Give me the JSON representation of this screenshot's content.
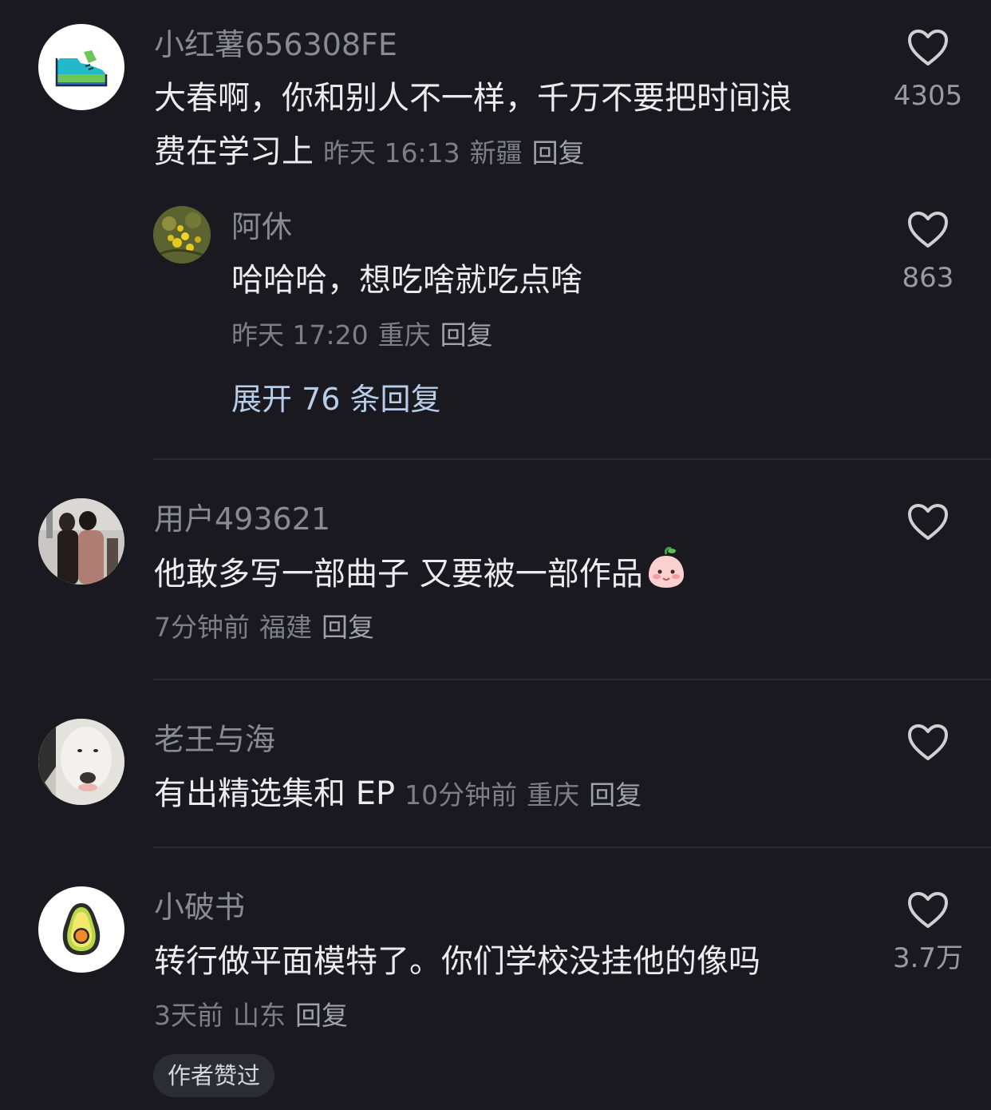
{
  "comments": [
    {
      "username": "小红薯656308FE",
      "text_line1": "大春啊，你和别人不一样，千万不要把时间浪",
      "text_line2": "费在学习上",
      "time": "昨天 16:13",
      "location": "新疆",
      "reply_label": "回复",
      "likes": "4305",
      "avatar_icon": "sneaker-icon",
      "reply": {
        "username": "阿休",
        "text": "哈哈哈，想吃啥就吃点啥",
        "time": "昨天 17:20",
        "location": "重庆",
        "reply_label": "回复",
        "likes": "863",
        "avatar_icon": "yellow-flowers-photo"
      },
      "expand_label": "展开 76 条回复"
    },
    {
      "username": "用户493621",
      "text": "他敢多写一部曲子 又要被一部作品",
      "emoji": "peach-face-emoji",
      "time": "7分钟前",
      "location": "福建",
      "reply_label": "回复",
      "likes": "",
      "avatar_icon": "street-people-photo"
    },
    {
      "username": "老王与海",
      "text": "有出精选集和 EP",
      "time": "10分钟前",
      "location": "重庆",
      "reply_label": "回复",
      "likes": "",
      "avatar_icon": "bull-terrier-photo"
    },
    {
      "username": "小破书",
      "text": "转行做平面模特了。你们学校没挂他的像吗",
      "time": "3天前",
      "location": "山东",
      "reply_label": "回复",
      "likes": "3.7万",
      "avatar_icon": "avocado-icon",
      "badge": "作者赞过"
    }
  ],
  "colors": {
    "background": "#19191f",
    "username": "#8a8a92",
    "body_text": "#ececf0",
    "meta_text": "#7e7e86",
    "expand_link": "#b7cdea",
    "badge_bg": "#2c2c33"
  }
}
